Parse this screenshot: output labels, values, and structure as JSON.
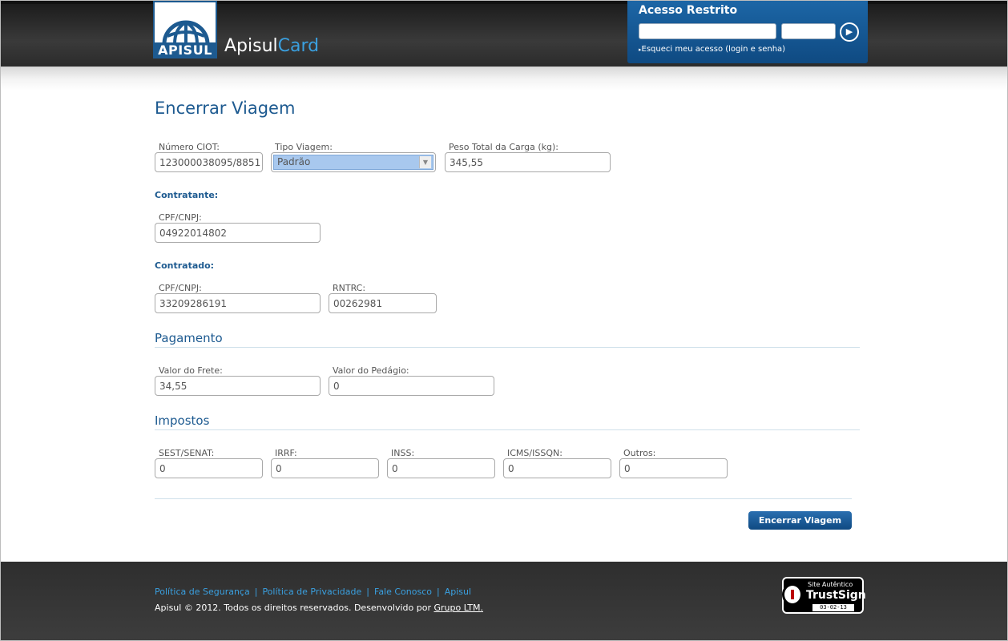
{
  "header": {
    "logo_text": "APISUL",
    "brand_main": "Apisul",
    "brand_accent": "Card",
    "login": {
      "title": "Acesso Restrito",
      "forgot": "Esqueci meu acesso (login e senha)"
    }
  },
  "page": {
    "title": "Encerrar Viagem"
  },
  "viagem": {
    "ciot_label": "Número CIOT:",
    "ciot_value": "123000038095/8851",
    "tipo_label": "Tipo Viagem:",
    "tipo_value": "Padrão",
    "peso_label": "Peso Total da Carga (kg):",
    "peso_value": "345,55"
  },
  "contratante": {
    "heading": "Contratante:",
    "cpf_label": "CPF/CNPJ:",
    "cpf_value": "04922014802"
  },
  "contratado": {
    "heading": "Contratado:",
    "cpf_label": "CPF/CNPJ:",
    "cpf_value": "33209286191",
    "rntrc_label": "RNTRC:",
    "rntrc_value": "00262981"
  },
  "pagamento": {
    "title": "Pagamento",
    "frete_label": "Valor do Frete:",
    "frete_value": "34,55",
    "pedagio_label": "Valor do Pedágio:",
    "pedagio_value": "0"
  },
  "impostos": {
    "title": "Impostos",
    "fields": [
      {
        "label": "SEST/SENAT:",
        "value": "0"
      },
      {
        "label": "IRRF:",
        "value": "0"
      },
      {
        "label": "INSS:",
        "value": "0"
      },
      {
        "label": "ICMS/ISSQN:",
        "value": "0"
      },
      {
        "label": "Outros:",
        "value": "0"
      }
    ]
  },
  "actions": {
    "submit": "Encerrar Viagem"
  },
  "footer": {
    "links": [
      "Política de Segurança",
      "Política de Privacidade",
      "Fale Conosco",
      "Apisul"
    ],
    "separator": "|",
    "copyright": "Apisul © 2012. Todos os direitos reservados. Desenvolvido por",
    "developer": "Grupo LTM.",
    "seal_top": "Site Autêntico",
    "seal_main": "TrustSign",
    "seal_date": "03-02-13"
  },
  "colors": {
    "accent": "#1d5a90",
    "link": "#3aa0e0",
    "header": "#2b2b2b",
    "login_panel": "#155a98"
  },
  "icons": {
    "login_go": "play-circle-icon",
    "forgot_arrow": "right-triangle-icon",
    "select_arrow": "chevron-down-icon",
    "logo": "globe-icon",
    "seal_lock": "lock-icon"
  }
}
